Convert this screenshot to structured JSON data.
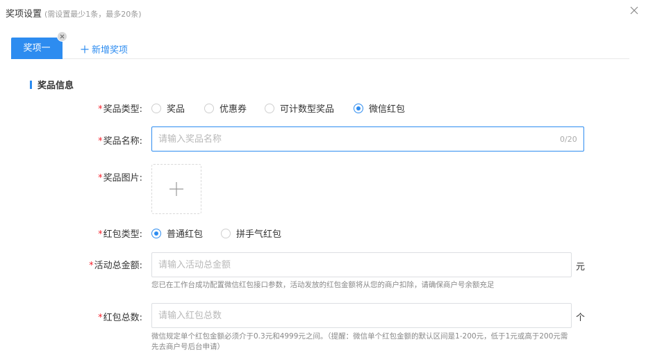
{
  "header": {
    "title": "奖项设置",
    "subtitle": "(需设置最少1条，最多20条)"
  },
  "tabs": {
    "active_label": "奖项一",
    "add_label": "新增奖项"
  },
  "section": {
    "title": "奖品信息"
  },
  "form": {
    "prize_type": {
      "label": "奖品类型:",
      "options": [
        "奖品",
        "优惠券",
        "可计数型奖品",
        "微信红包"
      ],
      "selected": "微信红包"
    },
    "prize_name": {
      "label": "奖品名称:",
      "placeholder": "请输入奖品名称",
      "value": "",
      "counter": "0/20"
    },
    "prize_image": {
      "label": "奖品图片:"
    },
    "envelope_type": {
      "label": "红包类型:",
      "options": [
        "普通红包",
        "拼手气红包"
      ],
      "selected": "普通红包"
    },
    "total_amount": {
      "label": "活动总金额:",
      "placeholder": "请输入活动总金额",
      "value": "",
      "unit": "元",
      "hint": "您已在工作台成功配置微信红包接口参数，活动发放的红包金额将从您的商户扣除，请确保商户号余额充足"
    },
    "envelope_count": {
      "label": "红包总数:",
      "placeholder": "请输入红包总数",
      "value": "",
      "unit": "个",
      "hint_line1": "微信规定单个红包金额必须介于0.3元和4999元之间。（提醒：微信单个红包金额的默认区间是1-200元，低于1元或高于200元需",
      "hint_line2": "先去商户号后台申请）"
    }
  },
  "colors": {
    "accent": "#2d8cf0",
    "required": "#f5222d"
  }
}
